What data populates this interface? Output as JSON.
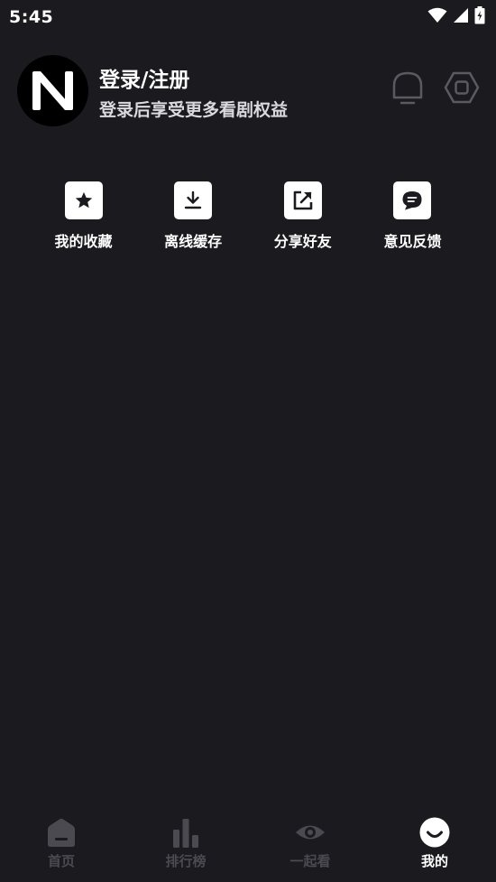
{
  "status_bar": {
    "time": "5:45",
    "icons": [
      "wifi-icon",
      "signal-icon",
      "battery-icon"
    ]
  },
  "profile": {
    "avatar_letter": "N",
    "title": "登录/注册",
    "subtitle": "登录后享受更多看剧权益",
    "icons": [
      "notification-bell-icon",
      "settings-hexagon-icon"
    ]
  },
  "quick_actions": [
    {
      "label": "我的收藏",
      "icon": "star-icon"
    },
    {
      "label": "离线缓存",
      "icon": "download-icon"
    },
    {
      "label": "分享好友",
      "icon": "share-icon"
    },
    {
      "label": "意见反馈",
      "icon": "feedback-chat-icon"
    }
  ],
  "tabs": [
    {
      "label": "首页",
      "icon": "home-icon",
      "active": false
    },
    {
      "label": "排行榜",
      "icon": "ranking-bars-icon",
      "active": false
    },
    {
      "label": "一起看",
      "icon": "eye-icon",
      "active": false
    },
    {
      "label": "我的",
      "icon": "smile-face-icon",
      "active": true
    }
  ],
  "colors": {
    "background": "#1a1a1f",
    "text_primary": "#ffffff",
    "tab_inactive": "#4a4a50",
    "header_icon": "#5a5a60"
  }
}
